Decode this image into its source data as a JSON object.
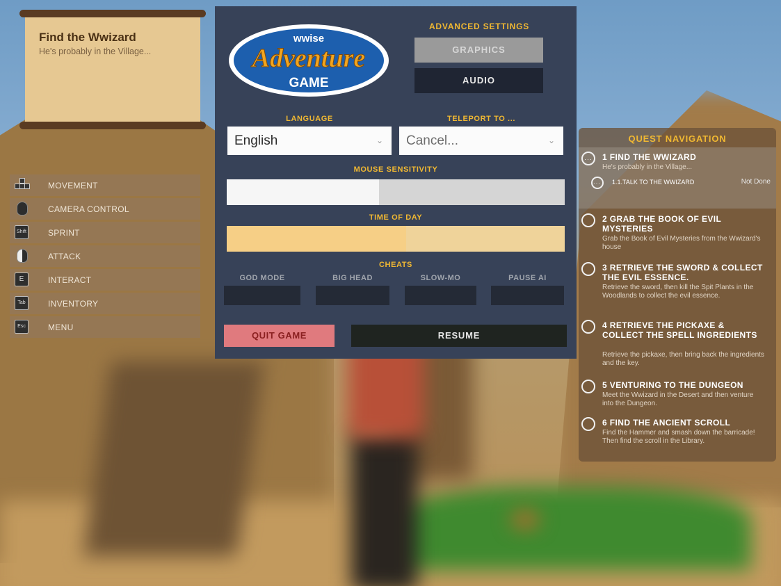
{
  "scroll": {
    "title": "Find the Wwizard",
    "subtitle": "He's probably in the Village..."
  },
  "keybinds": [
    {
      "label": "MOVEMENT",
      "icon": "arrow-keys-icon"
    },
    {
      "label": "CAMERA CONTROL",
      "icon": "mouse-icon"
    },
    {
      "label": "SPRINT",
      "icon": "shift-key-icon",
      "key": "Shift"
    },
    {
      "label": "ATTACK",
      "icon": "mouse-left-click-icon"
    },
    {
      "label": "INTERACT",
      "icon": "e-key-icon",
      "key": "E"
    },
    {
      "label": "INVENTORY",
      "icon": "tab-key-icon",
      "key": "Tab"
    },
    {
      "label": "MENU",
      "icon": "esc-key-icon",
      "key": "Esc"
    }
  ],
  "menu": {
    "logo": {
      "line1": "wwise",
      "line2": "Adventure",
      "line3": "GAME"
    },
    "advanced_settings_title": "ADVANCED SETTINGS",
    "graphics_label": "GRAPHICS",
    "audio_label": "AUDIO",
    "language_title": "LANGUAGE",
    "language_value": "English",
    "teleport_title": "TELEPORT TO ...",
    "teleport_value": "Cancel...",
    "mouse_sensitivity_title": "MOUSE SENSITIVITY",
    "mouse_sensitivity_level": 0.45,
    "time_of_day_title": "TIME OF DAY",
    "time_of_day_level": 0.53,
    "cheats_title": "CHEATS",
    "cheats": [
      "GOD MODE",
      "BIG HEAD",
      "SLOW-MO",
      "PAUSE AI"
    ],
    "quit_label": "QUIT GAME",
    "resume_label": "RESUME"
  },
  "quest_navigation": {
    "title": "QUEST NAVIGATION",
    "quests": [
      {
        "title": "1 FIND THE WWIZARD",
        "desc": "He's probably in the Village...",
        "subtask": {
          "label": "1.1.TALK TO THE WWIZARD",
          "status": "Not Done"
        }
      },
      {
        "title": "2 GRAB THE BOOK OF EVIL MYSTERIES",
        "desc": "Grab the Book of Evil Mysteries from the Wwizard's house"
      },
      {
        "title": "3 RETRIEVE THE SWORD & COLLECT THE EVIL ESSENCE.",
        "desc": "Retrieve the sword, then kill the Spit Plants in the Woodlands to collect the evil essence."
      },
      {
        "title": "4 RETRIEVE THE PICKAXE & COLLECT THE SPELL INGREDIENTS",
        "desc": "Retrieve the pickaxe, then bring back the ingredients and the key."
      },
      {
        "title": "5 VENTURING TO THE DUNGEON",
        "desc": "Meet the Wwizard in the Desert and then venture into the Dungeon."
      },
      {
        "title": "6 FIND THE ANCIENT SCROLL",
        "desc": "Find the Hammer and smash down the barricade! Then find the scroll in the Library."
      }
    ]
  },
  "colors": {
    "panel": "#374258",
    "accent": "#f0b832",
    "slider_fill_light": "#f6f6f6",
    "slider_track_light": "#d5d5d5",
    "slider_fill_warm": "#f6cf86",
    "slider_track_warm": "#efd39a",
    "quit": "#e07a7e"
  }
}
